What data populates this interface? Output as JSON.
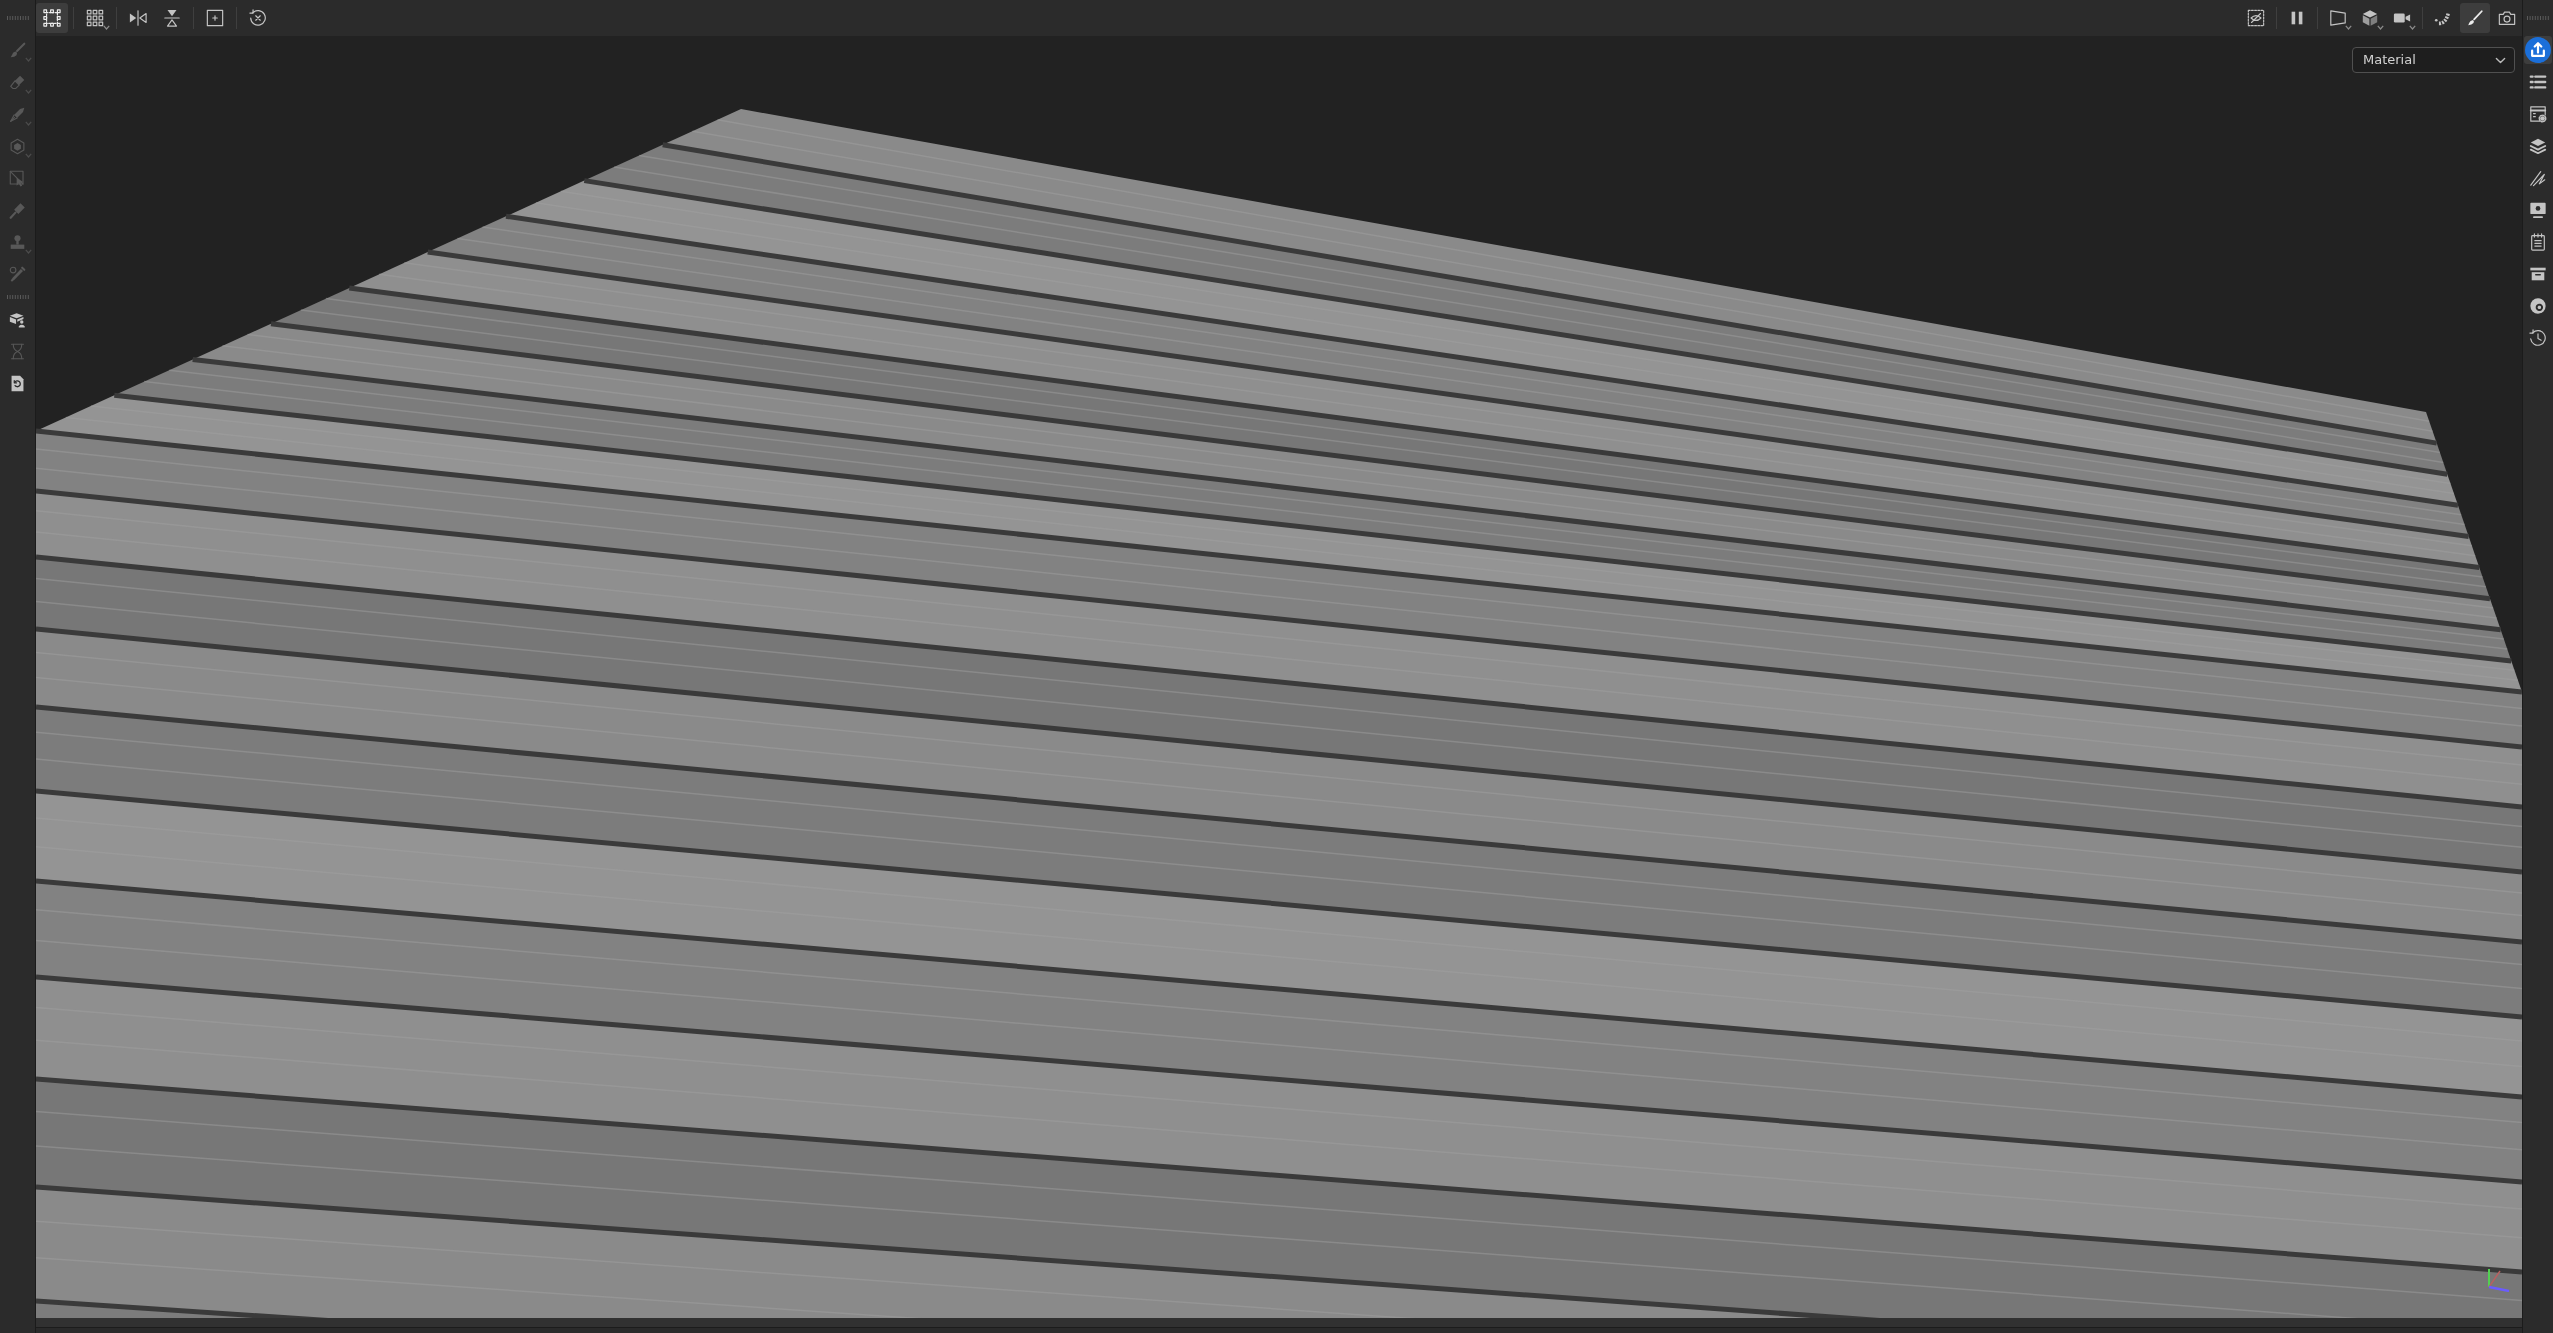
{
  "top_toolbar": {
    "left_groups": [
      [
        {
          "kind": "selection-mode",
          "selected": true,
          "menu": false
        }
      ],
      [
        {
          "kind": "grid",
          "selected": false,
          "menu": true
        }
      ],
      [
        {
          "kind": "mirror-x",
          "selected": false,
          "menu": false
        },
        {
          "kind": "mirror-y",
          "selected": false,
          "menu": false
        }
      ],
      [
        {
          "kind": "fit",
          "selected": false,
          "menu": false
        }
      ],
      [
        {
          "kind": "reset",
          "selected": false,
          "menu": false
        }
      ]
    ],
    "right_groups": [
      [
        {
          "kind": "hide",
          "selected": false,
          "menu": false
        }
      ],
      [
        {
          "kind": "pause",
          "selected": false,
          "menu": false
        }
      ],
      [
        {
          "kind": "frame",
          "selected": false,
          "menu": true
        },
        {
          "kind": "cube",
          "selected": false,
          "menu": true
        },
        {
          "kind": "camera",
          "selected": false,
          "menu": true
        }
      ],
      [
        {
          "kind": "bones",
          "selected": false,
          "menu": false
        },
        {
          "kind": "paint",
          "selected": true,
          "menu": false
        },
        {
          "kind": "snapshot",
          "selected": false,
          "menu": false
        }
      ]
    ]
  },
  "left_toolbar": {
    "groups": [
      [
        {
          "kind": "brush",
          "selected": false,
          "disabled": true,
          "menu": true
        },
        {
          "kind": "eraser",
          "selected": false,
          "disabled": true,
          "menu": true
        },
        {
          "kind": "projection",
          "selected": false,
          "disabled": true,
          "menu": true
        },
        {
          "kind": "polygon-fill",
          "selected": false,
          "disabled": true,
          "menu": true
        },
        {
          "kind": "geometry-mask",
          "selected": false,
          "disabled": true,
          "menu": false
        },
        {
          "kind": "smudge",
          "selected": false,
          "disabled": true,
          "menu": false
        },
        {
          "kind": "clone",
          "selected": false,
          "disabled": true,
          "menu": true
        },
        {
          "kind": "picker",
          "selected": false,
          "disabled": true,
          "menu": false
        }
      ],
      [
        {
          "kind": "bake",
          "selected": false,
          "disabled": false,
          "menu": false
        },
        {
          "kind": "hourglass",
          "selected": false,
          "disabled": true,
          "menu": false
        },
        {
          "kind": "doc-refresh",
          "selected": false,
          "disabled": false,
          "menu": false
        }
      ]
    ]
  },
  "viewport": {
    "display_mode": {
      "value": "Material"
    }
  },
  "right_sidebar": {
    "items": [
      {
        "kind": "export",
        "selected": true
      },
      {
        "kind": "layers-list",
        "selected": false
      },
      {
        "kind": "texture-settings",
        "selected": false
      },
      {
        "kind": "layers",
        "selected": false
      },
      {
        "kind": "properties",
        "selected": false
      },
      {
        "kind": "display-settings",
        "selected": false
      },
      {
        "kind": "notes",
        "selected": false
      },
      {
        "kind": "shelf",
        "selected": false
      },
      {
        "kind": "environment",
        "selected": false
      },
      {
        "kind": "history",
        "selected": false
      }
    ]
  }
}
